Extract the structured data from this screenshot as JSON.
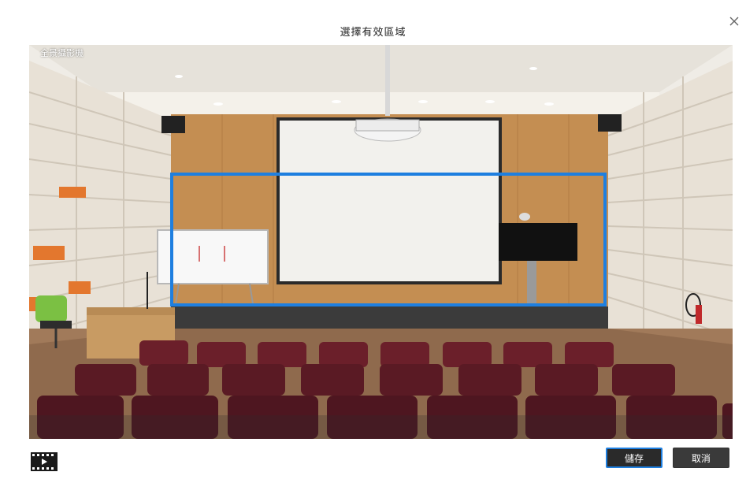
{
  "dialog": {
    "title": "選擇有效區域",
    "close_icon": "close-icon"
  },
  "viewer": {
    "camera_label": "全景攝影機"
  },
  "toolbar": {
    "film_icon": "film-play-icon",
    "save_label": "儲存",
    "cancel_label": "取消"
  },
  "colors": {
    "roi_border": "#1e7fe0",
    "button_bg": "#2a2a2a",
    "save_outline": "#1e7fe0"
  }
}
